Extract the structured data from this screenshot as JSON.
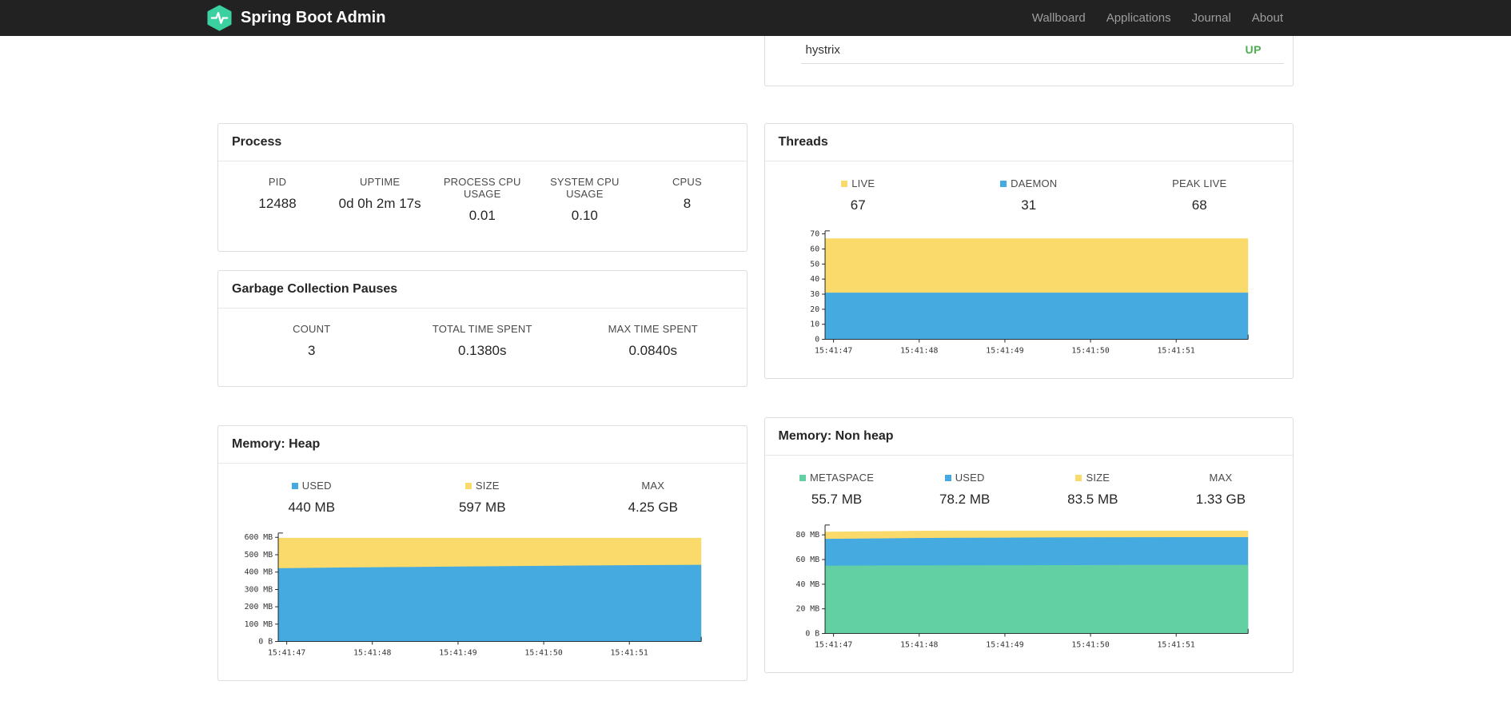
{
  "navbar": {
    "brand": "Spring Boot Admin",
    "brand_color": "#3ad0a0",
    "items": [
      {
        "label": "Wallboard"
      },
      {
        "label": "Applications"
      },
      {
        "label": "Journal"
      },
      {
        "label": "About"
      }
    ]
  },
  "status_panel": {
    "rows": [
      {
        "name": "hystrix",
        "status": "UP",
        "status_color": "#4CAF50"
      }
    ]
  },
  "process": {
    "title": "Process",
    "metrics": [
      {
        "label": "PID",
        "value": "12488"
      },
      {
        "label": "UPTIME",
        "value": "0d 0h 2m 17s"
      },
      {
        "label": "PROCESS CPU USAGE",
        "value": "0.01"
      },
      {
        "label": "SYSTEM CPU USAGE",
        "value": "0.10"
      },
      {
        "label": "CPUS",
        "value": "8"
      }
    ]
  },
  "gc": {
    "title": "Garbage Collection Pauses",
    "metrics": [
      {
        "label": "COUNT",
        "value": "3"
      },
      {
        "label": "TOTAL TIME SPENT",
        "value": "0.1380s"
      },
      {
        "label": "MAX TIME SPENT",
        "value": "0.0840s"
      }
    ]
  },
  "threads_card": {
    "title": "Threads",
    "metrics": [
      {
        "label": "LIVE",
        "value": "67",
        "swatch": "#fada6a"
      },
      {
        "label": "DAEMON",
        "value": "31",
        "swatch": "#45aae0"
      },
      {
        "label": "PEAK LIVE",
        "value": "68"
      }
    ]
  },
  "heap_card": {
    "title": "Memory: Heap",
    "metrics": [
      {
        "label": "USED",
        "value": "440 MB",
        "swatch": "#45aae0"
      },
      {
        "label": "SIZE",
        "value": "597 MB",
        "swatch": "#fada6a"
      },
      {
        "label": "MAX",
        "value": "4.25 GB"
      }
    ]
  },
  "nonheap_card": {
    "title": "Memory: Non heap",
    "metrics": [
      {
        "label": "METASPACE",
        "value": "55.7 MB",
        "swatch": "#62d0a2"
      },
      {
        "label": "USED",
        "value": "78.2 MB",
        "swatch": "#45aae0"
      },
      {
        "label": "SIZE",
        "value": "83.5 MB",
        "swatch": "#fada6a"
      },
      {
        "label": "MAX",
        "value": "1.33 GB"
      }
    ]
  },
  "chart_data": [
    {
      "id": "threads",
      "type": "area",
      "title": "Threads",
      "stacking": "absolute-overlay",
      "ylim": [
        0,
        72
      ],
      "x_ticks": [
        "15:41:47",
        "15:41:48",
        "15:41:49",
        "15:41:50",
        "15:41:51"
      ],
      "y_ticks": [
        {
          "v": 0,
          "label": "0"
        },
        {
          "v": 10,
          "label": "10"
        },
        {
          "v": 20,
          "label": "20"
        },
        {
          "v": 30,
          "label": "30"
        },
        {
          "v": 40,
          "label": "40"
        },
        {
          "v": 50,
          "label": "50"
        },
        {
          "v": 60,
          "label": "60"
        },
        {
          "v": 70,
          "label": "70"
        }
      ],
      "series": [
        {
          "name": "LIVE",
          "color": "#fada6a",
          "values": [
            67,
            67,
            67,
            67,
            67,
            67,
            67,
            67
          ]
        },
        {
          "name": "DAEMON",
          "color": "#45aae0",
          "values": [
            31,
            31,
            31,
            31,
            31,
            31,
            31,
            31
          ]
        }
      ]
    },
    {
      "id": "heap",
      "type": "area",
      "title": "Memory: Heap",
      "stacking": "absolute-overlay",
      "ylim": [
        0,
        625
      ],
      "x_ticks": [
        "15:41:47",
        "15:41:48",
        "15:41:49",
        "15:41:50",
        "15:41:51"
      ],
      "y_ticks": [
        {
          "v": 0,
          "label": "0 B"
        },
        {
          "v": 100,
          "label": "100 MB"
        },
        {
          "v": 200,
          "label": "200 MB"
        },
        {
          "v": 300,
          "label": "300 MB"
        },
        {
          "v": 400,
          "label": "400 MB"
        },
        {
          "v": 500,
          "label": "500 MB"
        },
        {
          "v": 600,
          "label": "600 MB"
        }
      ],
      "series": [
        {
          "name": "SIZE",
          "color": "#fada6a",
          "values": [
            597,
            597,
            597,
            597,
            597,
            597,
            597,
            597
          ]
        },
        {
          "name": "USED",
          "color": "#45aae0",
          "values": [
            422,
            426,
            429,
            432,
            435,
            438,
            440,
            442
          ]
        }
      ]
    },
    {
      "id": "nonheap",
      "type": "area",
      "title": "Memory: Non heap",
      "stacking": "absolute-overlay",
      "ylim": [
        0,
        88
      ],
      "x_ticks": [
        "15:41:47",
        "15:41:48",
        "15:41:49",
        "15:41:50",
        "15:41:51"
      ],
      "y_ticks": [
        {
          "v": 0,
          "label": "0 B"
        },
        {
          "v": 20,
          "label": "20 MB"
        },
        {
          "v": 40,
          "label": "40 MB"
        },
        {
          "v": 60,
          "label": "60 MB"
        },
        {
          "v": 80,
          "label": "80 MB"
        }
      ],
      "series": [
        {
          "name": "SIZE",
          "color": "#fada6a",
          "values": [
            82.6,
            83.0,
            83.5,
            83.5,
            83.5,
            83.5,
            83.5,
            83.5
          ]
        },
        {
          "name": "USED",
          "color": "#45aae0",
          "values": [
            76.8,
            77.2,
            77.6,
            77.8,
            78.0,
            78.1,
            78.2,
            78.2
          ]
        },
        {
          "name": "METASPACE",
          "color": "#62d0a2",
          "values": [
            55.0,
            55.2,
            55.3,
            55.4,
            55.5,
            55.6,
            55.7,
            55.7
          ]
        }
      ]
    }
  ]
}
